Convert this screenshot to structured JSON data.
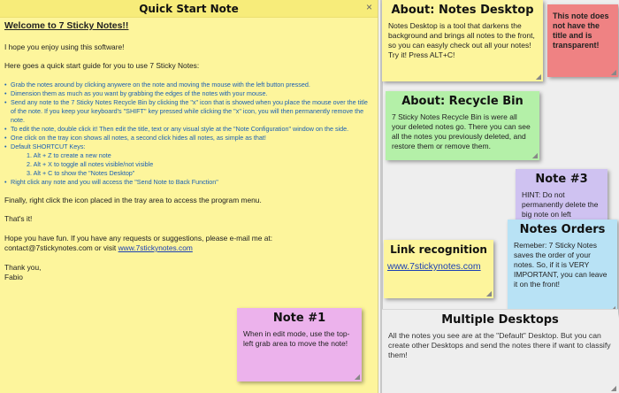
{
  "quick_start": {
    "title": "Quick Start Note",
    "close_glyph": "×",
    "welcome": "Welcome to 7 Sticky Notes!!",
    "p1": "I hope you enjoy using this software!",
    "p2": "Here goes a quick start guide for you to use 7 Sticky Notes:",
    "steps": [
      "Grab the notes around by clicking anywere on the note and moving the mouse with the left button pressed.",
      "Dimension them as much as you want by grabbing the edges of the notes with your mouse.",
      "Send any note to the 7 Sticky Notes Recycle Bin by clicking the \"x\" icon that is showed when you place the mouse over the title of the note. If you keep your keyboard's \"SHIFT\" key pressed while clicking the \"x\" icon, you will then permanently remove the note.",
      "To edit the note, double click it! Then edit the title, text or any visual style at the \"Note Configuration\" window on the side.",
      "One click on the tray icon shows all notes, a second click hides all notes, as simple as that!",
      "Default SHORTCUT Keys:",
      "Right click any note and you will access the \"Send Note to Back Function\""
    ],
    "shortcuts": [
      "1. Alt + Z to create a new note",
      "2. Alt + X to toggle all notes visible/not visible",
      "3. Alt + C to show the \"Notes Desktop\""
    ],
    "p3": "Finally, right click the icon placed in the tray area to access the program menu.",
    "p4": "That's it!",
    "p5": "Hope you have fun. If you have any requests or suggestions, please e-mail me at:",
    "contact_prefix": "contact@7stickynotes.com or visit ",
    "contact_link": "www.7stickynotes.com",
    "thanks": "Thank you,",
    "sign": "Fabio"
  },
  "note1": {
    "title": "Note #1",
    "body": "When in edit mode, use the top-left grab area to move the note!"
  },
  "notes_desktop": {
    "title": "About: Notes Desktop",
    "body": "Notes Desktop is a tool that darkens the background and brings all notes to the front, so you can easyly check out all your notes! Try it! Press ALT+C!"
  },
  "transparent_note": {
    "body": "This note does not have the title and is transparent!"
  },
  "recycle_bin": {
    "title": "About: Recycle Bin",
    "body": "7 Sticky Notes Recycle Bin is were all your deleted notes go. There you can see all the notes you previously deleted, and restore them or remove them."
  },
  "note3": {
    "title": "Note #3",
    "body": "HINT: Do not permanently delete the big note on left"
  },
  "notes_orders": {
    "title": "Notes Orders",
    "body": "Remeber: 7 Sticky Notes saves the order of your notes. So, if it is VERY IMPORTANT, you can leave it on the front!"
  },
  "link_recognition": {
    "title": "Link recognition",
    "link": "www.7stickynotes.com"
  },
  "multiple_desktops": {
    "title": "Multiple Desktops",
    "body": "All the notes you see are at the \"Default\" Desktop. But you can create other Desktops and send the notes there if want to classify them!"
  }
}
